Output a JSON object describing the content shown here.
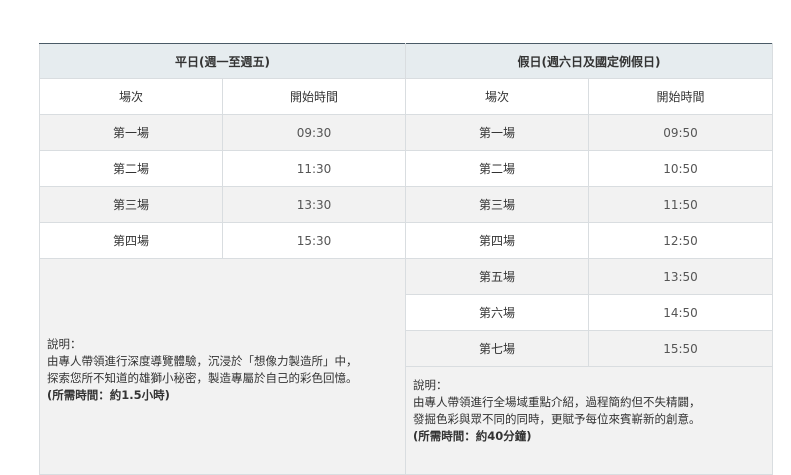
{
  "weekday": {
    "header": "平日(週一至週五)",
    "col_session": "場次",
    "col_start": "開始時間",
    "rows": [
      {
        "session": "第一場",
        "time": "09:30"
      },
      {
        "session": "第二場",
        "time": "11:30"
      },
      {
        "session": "第三場",
        "time": "13:30"
      },
      {
        "session": "第四場",
        "time": "15:30"
      }
    ],
    "note": {
      "title": "說明：",
      "line1": "由專人帶領進行深度導覽體驗，沉浸於「想像力製造所」中，",
      "line2": "探索您所不知道的雄獅小秘密，製造專屬於自己的彩色回憶。",
      "duration": "(所需時間：約1.5小時)"
    }
  },
  "holiday": {
    "header": "假日(週六日及國定例假日)",
    "col_session": "場次",
    "col_start": "開始時間",
    "rows": [
      {
        "session": "第一場",
        "time": "09:50"
      },
      {
        "session": "第二場",
        "time": "10:50"
      },
      {
        "session": "第三場",
        "time": "11:50"
      },
      {
        "session": "第四場",
        "time": "12:50"
      },
      {
        "session": "第五場",
        "time": "13:50"
      },
      {
        "session": "第六場",
        "time": "14:50"
      },
      {
        "session": "第七場",
        "time": "15:50"
      }
    ],
    "note": {
      "title": "說明：",
      "line1": "由專人帶領進行全場域重點介紹，過程簡約但不失精闢，",
      "line2": "發掘色彩與眾不同的同時，更賦予每位來賓嶄新的創意。",
      "duration": "(所需時間：約40分鐘)"
    }
  }
}
